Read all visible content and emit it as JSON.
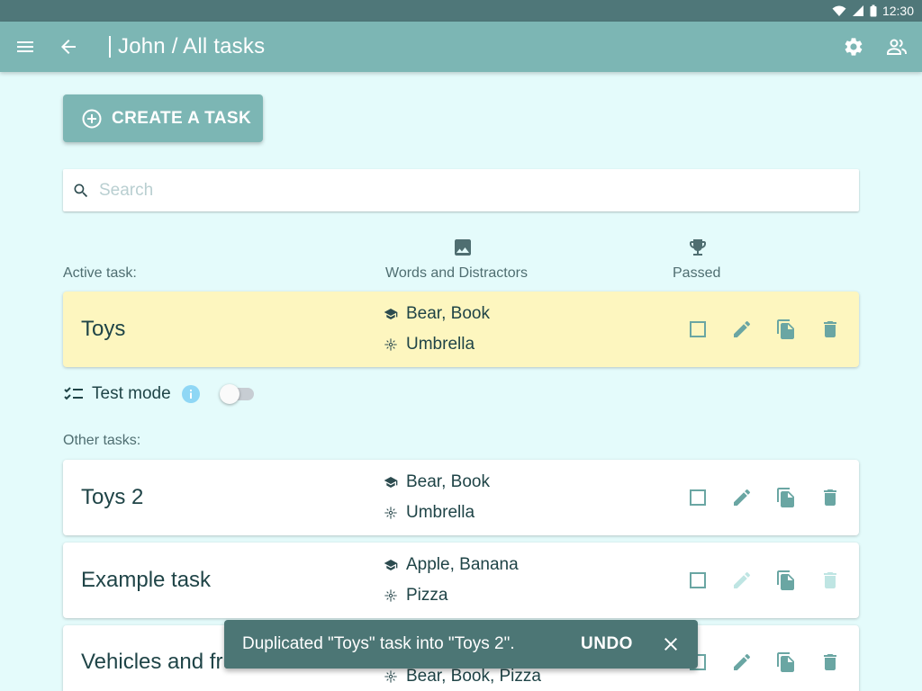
{
  "status_bar": {
    "time": "12:30"
  },
  "app_bar": {
    "title": "John / All tasks"
  },
  "create_button": {
    "label": "CREATE A TASK"
  },
  "search": {
    "placeholder": "Search",
    "value": ""
  },
  "columns": {
    "active_label": "Active task:",
    "words_label": "Words and Distractors",
    "passed_label": "Passed"
  },
  "active_task": {
    "name": "Toys",
    "words": "Bear, Book",
    "distractors": "Umbrella",
    "passed": false
  },
  "test_mode": {
    "label": "Test mode",
    "enabled": false
  },
  "other_tasks_label": "Other tasks:",
  "other_tasks": [
    {
      "name": "Toys 2",
      "words": "Bear, Book",
      "distractors": "Umbrella",
      "passed": false,
      "editable": true
    },
    {
      "name": "Example task",
      "words": "Apple, Banana",
      "distractors": "Pizza",
      "passed": false,
      "editable": false
    },
    {
      "name": "Vehicles and fruits",
      "words": "",
      "distractors": "Bear, Book, Pizza",
      "passed": false,
      "editable": true
    }
  ],
  "snackbar": {
    "message": "Duplicated \"Toys\" task into \"Toys 2\".",
    "action": "UNDO"
  },
  "colors": {
    "app_bar": "#7cb6b4",
    "status_bar": "#4f7779",
    "background": "#e4fbfb",
    "active_card": "#fdf6bf",
    "icon": "#6aa6a3",
    "disabled_icon": "#bfe5e3",
    "snackbar": "#4c7675"
  }
}
